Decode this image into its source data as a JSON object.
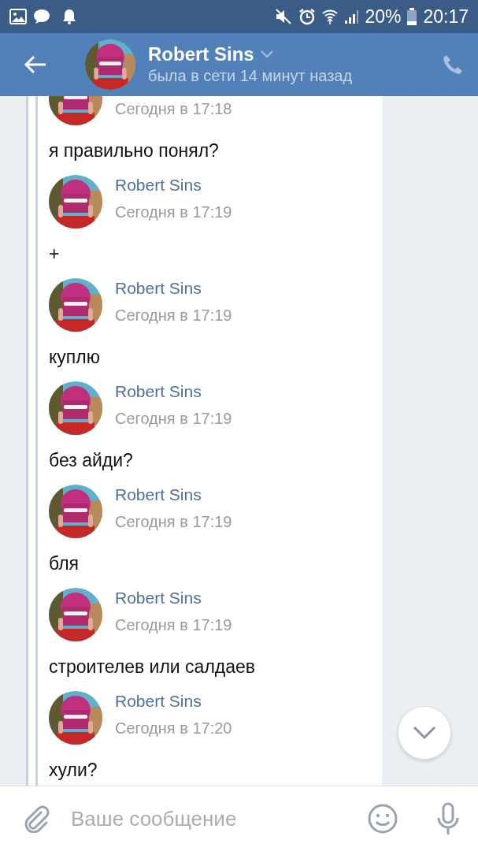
{
  "status_bar": {
    "battery": "20%",
    "time": "20:17"
  },
  "header": {
    "name": "Robert Sins",
    "status": "была в сети 14 минут назад"
  },
  "messages": [
    {
      "time": "Сегодня в 17:18",
      "text": "я правильно понял?"
    },
    {
      "name": "Robert Sins",
      "time": "Сегодня в 17:19",
      "text": "+"
    },
    {
      "name": "Robert Sins",
      "time": "Сегодня в 17:19",
      "text": "куплю"
    },
    {
      "name": "Robert Sins",
      "time": "Сегодня в 17:19",
      "text": "без айди?"
    },
    {
      "name": "Robert Sins",
      "time": "Сегодня в 17:19",
      "text": "бля"
    },
    {
      "name": "Robert Sins",
      "time": "Сегодня в 17:19",
      "text": "строителев или салдаев"
    },
    {
      "name": "Robert Sins",
      "time": "Сегодня в 17:20",
      "text": "хули?"
    }
  ],
  "composer": {
    "placeholder": "Ваше сообщение"
  }
}
